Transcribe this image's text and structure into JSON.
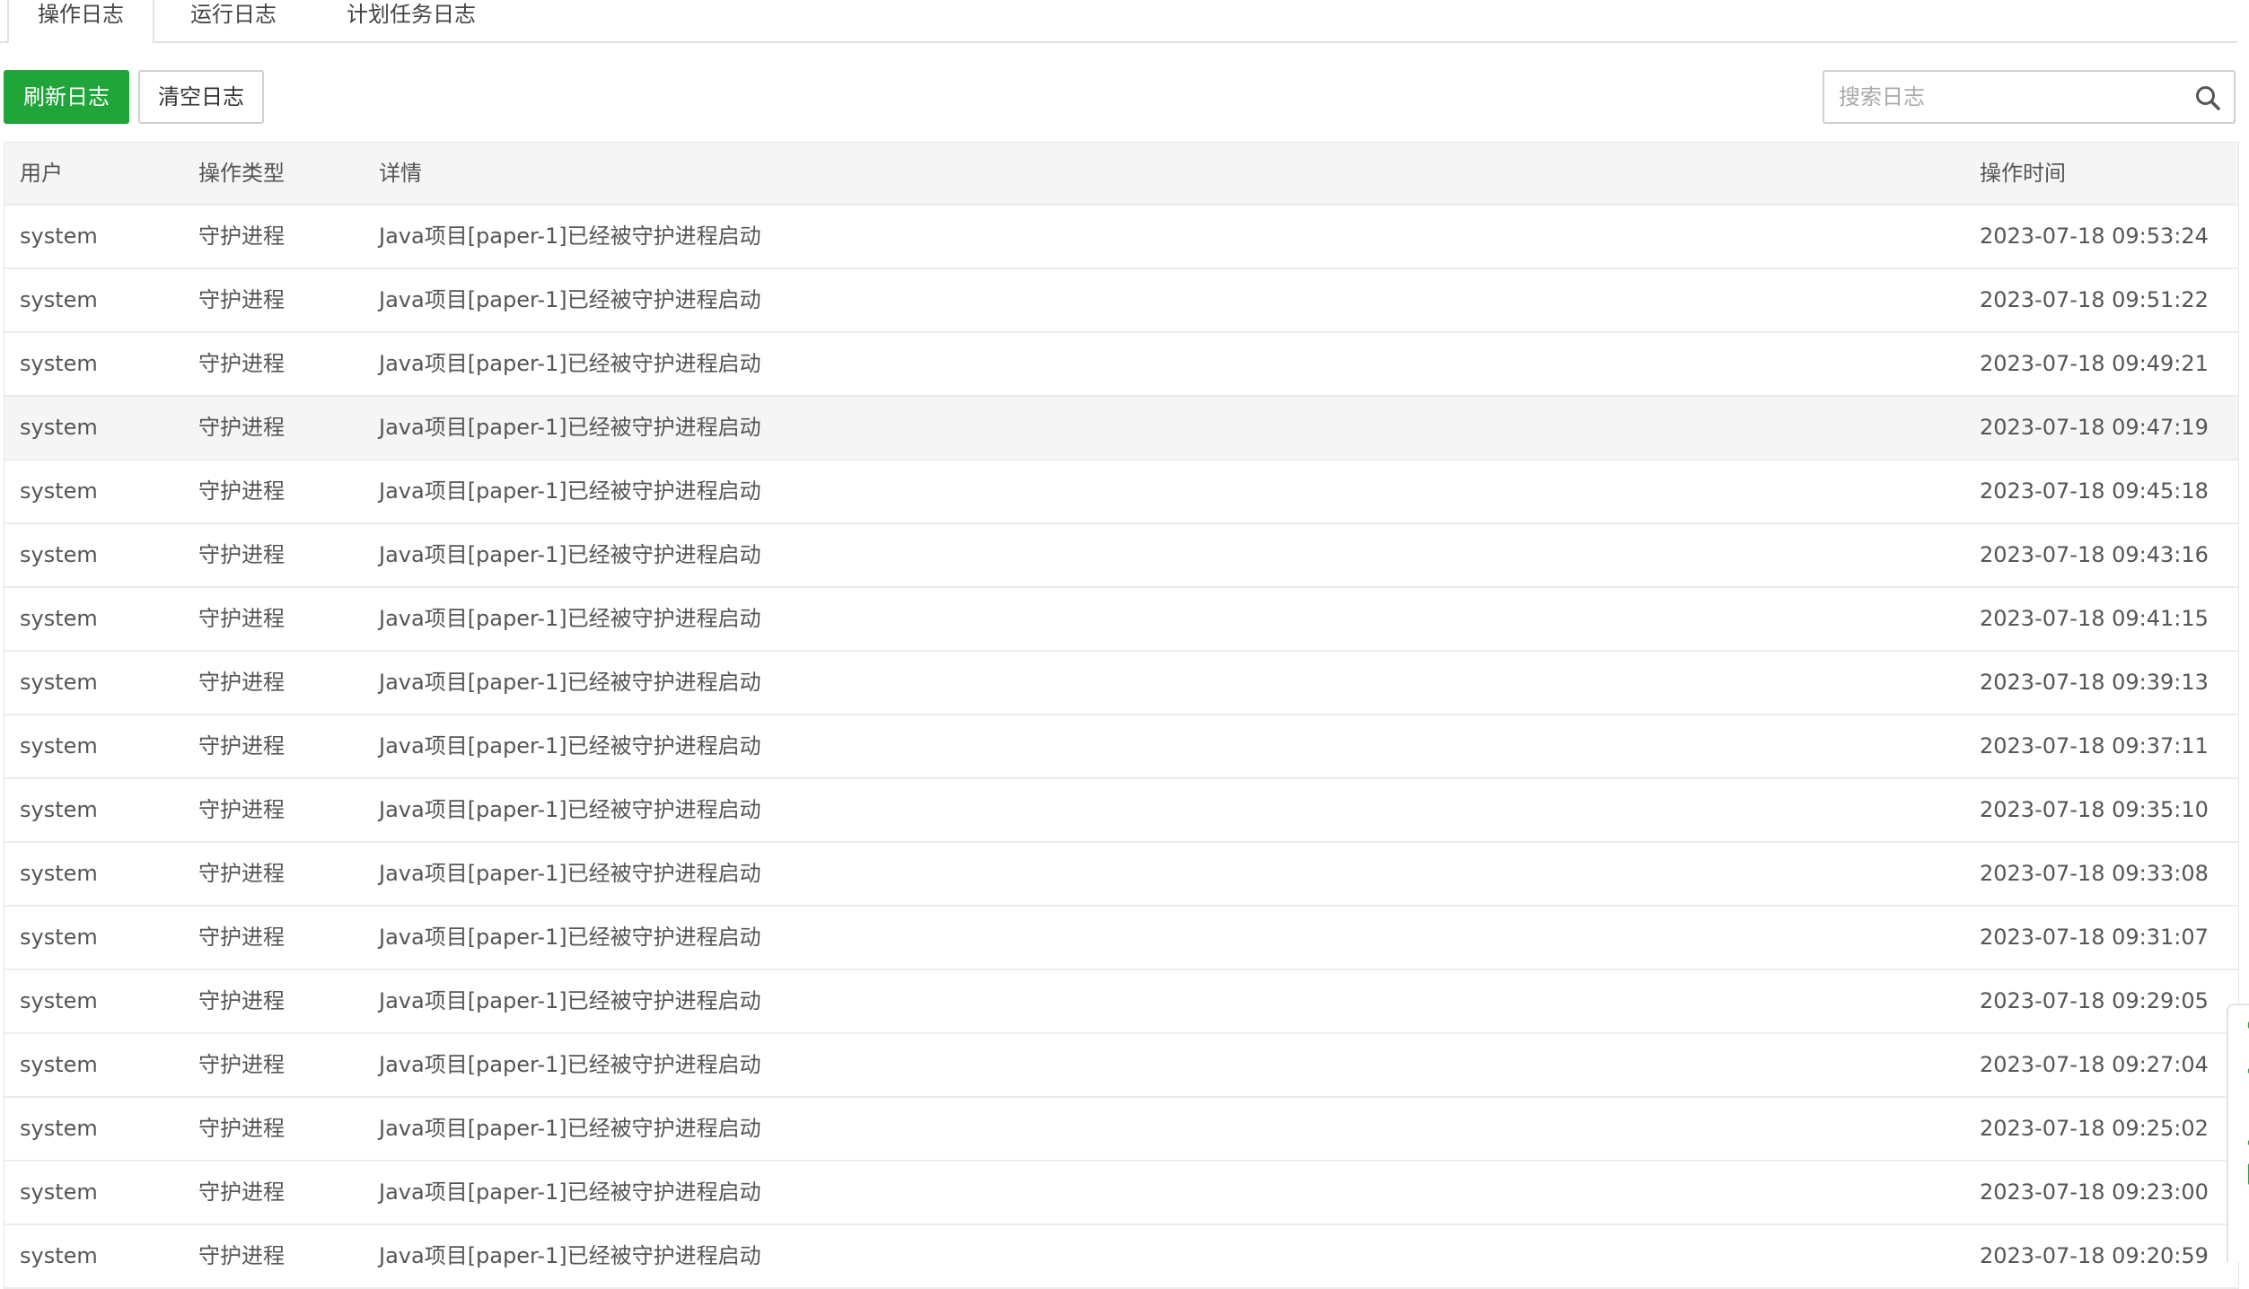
{
  "tabs": [
    {
      "label": "操作日志",
      "active": true
    },
    {
      "label": "运行日志",
      "active": false
    },
    {
      "label": "计划任务日志",
      "active": false
    }
  ],
  "toolbar": {
    "refresh_label": "刷新日志",
    "clear_label": "清空日志"
  },
  "search": {
    "placeholder": "搜索日志",
    "value": "",
    "icon": "search-icon"
  },
  "table": {
    "columns": [
      "用户",
      "操作类型",
      "详情",
      "操作时间"
    ],
    "rows": [
      {
        "user": "system",
        "type": "守护进程",
        "detail": "Java项目[paper-1]已经被守护进程启动",
        "time": "2023-07-18 09:53:24"
      },
      {
        "user": "system",
        "type": "守护进程",
        "detail": "Java项目[paper-1]已经被守护进程启动",
        "time": "2023-07-18 09:51:22"
      },
      {
        "user": "system",
        "type": "守护进程",
        "detail": "Java项目[paper-1]已经被守护进程启动",
        "time": "2023-07-18 09:49:21"
      },
      {
        "user": "system",
        "type": "守护进程",
        "detail": "Java项目[paper-1]已经被守护进程启动",
        "time": "2023-07-18 09:47:19"
      },
      {
        "user": "system",
        "type": "守护进程",
        "detail": "Java项目[paper-1]已经被守护进程启动",
        "time": "2023-07-18 09:45:18"
      },
      {
        "user": "system",
        "type": "守护进程",
        "detail": "Java项目[paper-1]已经被守护进程启动",
        "time": "2023-07-18 09:43:16"
      },
      {
        "user": "system",
        "type": "守护进程",
        "detail": "Java项目[paper-1]已经被守护进程启动",
        "time": "2023-07-18 09:41:15"
      },
      {
        "user": "system",
        "type": "守护进程",
        "detail": "Java项目[paper-1]已经被守护进程启动",
        "time": "2023-07-18 09:39:13"
      },
      {
        "user": "system",
        "type": "守护进程",
        "detail": "Java项目[paper-1]已经被守护进程启动",
        "time": "2023-07-18 09:37:11"
      },
      {
        "user": "system",
        "type": "守护进程",
        "detail": "Java项目[paper-1]已经被守护进程启动",
        "time": "2023-07-18 09:35:10"
      },
      {
        "user": "system",
        "type": "守护进程",
        "detail": "Java项目[paper-1]已经被守护进程启动",
        "time": "2023-07-18 09:33:08"
      },
      {
        "user": "system",
        "type": "守护进程",
        "detail": "Java项目[paper-1]已经被守护进程启动",
        "time": "2023-07-18 09:31:07"
      },
      {
        "user": "system",
        "type": "守护进程",
        "detail": "Java项目[paper-1]已经被守护进程启动",
        "time": "2023-07-18 09:29:05"
      },
      {
        "user": "system",
        "type": "守护进程",
        "detail": "Java项目[paper-1]已经被守护进程启动",
        "time": "2023-07-18 09:27:04"
      },
      {
        "user": "system",
        "type": "守护进程",
        "detail": "Java项目[paper-1]已经被守护进程启动",
        "time": "2023-07-18 09:25:02"
      },
      {
        "user": "system",
        "type": "守护进程",
        "detail": "Java项目[paper-1]已经被守护进程启动",
        "time": "2023-07-18 09:23:00"
      },
      {
        "user": "system",
        "type": "守护进程",
        "detail": "Java项目[paper-1]已经被守护进程启动",
        "time": "2023-07-18 09:20:59"
      }
    ],
    "highlighted_row": 3
  },
  "colors": {
    "primary": "#20a53a",
    "header_bg": "#f5f5f5",
    "row_highlight": "#f5f5f5"
  }
}
